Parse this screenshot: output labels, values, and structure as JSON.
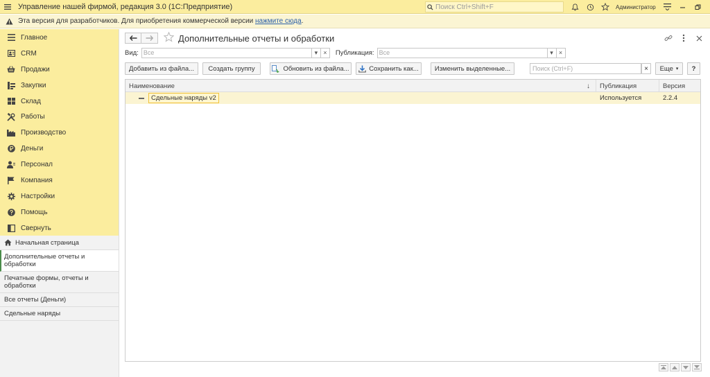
{
  "titlebar": {
    "title": "Управление нашей фирмой, редакция 3.0  (1С:Предприятие)",
    "search_placeholder": "Поиск Ctrl+Shift+F",
    "user": "Администратор"
  },
  "warning": {
    "text": "Эта версия для разработчиков. Для приобретения коммерческой версии ",
    "link": "нажмите сюда",
    "suffix": "."
  },
  "sidebar": {
    "sections": [
      {
        "label": "Главное",
        "icon": "menu-icon"
      },
      {
        "label": "CRM",
        "icon": "contacts-icon"
      },
      {
        "label": "Продажи",
        "icon": "basket-icon"
      },
      {
        "label": "Закупки",
        "icon": "purchases-icon"
      },
      {
        "label": "Склад",
        "icon": "warehouse-icon"
      },
      {
        "label": "Работы",
        "icon": "tools-icon"
      },
      {
        "label": "Производство",
        "icon": "factory-icon"
      },
      {
        "label": "Деньги",
        "icon": "money-icon"
      },
      {
        "label": "Персонал",
        "icon": "staff-icon"
      },
      {
        "label": "Компания",
        "icon": "flag-icon"
      },
      {
        "label": "Настройки",
        "icon": "gear-icon"
      },
      {
        "label": "Помощь",
        "icon": "help-icon"
      },
      {
        "label": "Свернуть",
        "icon": "collapse-icon"
      }
    ],
    "open_windows": [
      {
        "label": "Начальная страница"
      },
      {
        "label": "Дополнительные отчеты и обработки"
      },
      {
        "label": "Печатные формы, отчеты и обработки"
      },
      {
        "label": "Все отчеты (Деньги)"
      },
      {
        "label": "Сдельные наряды"
      }
    ]
  },
  "page": {
    "title": "Дополнительные отчеты и обработки",
    "filter_kind_label": "Вид:",
    "filter_kind_placeholder": "Все",
    "filter_pub_label": "Публикация:",
    "filter_pub_placeholder": "Все"
  },
  "toolbar": {
    "add_from_file": "Добавить из файла...",
    "create_group": "Создать группу",
    "update_from_file": "Обновить из файла...",
    "save_as": "Сохранить как...",
    "change_selected": "Изменить выделенные...",
    "search_placeholder": "Поиск (Ctrl+F)",
    "more": "Еще",
    "help": "?"
  },
  "table": {
    "columns": [
      "Наименование",
      "Публикация",
      "Версия"
    ],
    "sort_indicator": "↓",
    "rows": [
      {
        "name": "Сдельные наряды v2",
        "publication": "Используется",
        "version": "2.2.4"
      }
    ]
  }
}
